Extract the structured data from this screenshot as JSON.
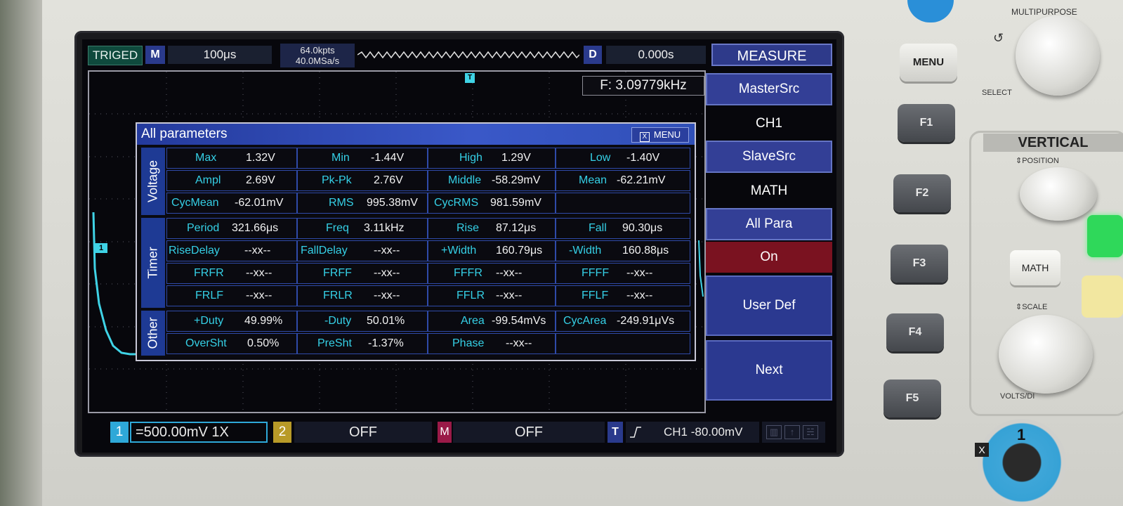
{
  "top_bar": {
    "trigger_status": "TRIGED",
    "mode_badge": "M",
    "timebase": "100μs",
    "memory_depth": "64.0kpts",
    "sample_rate": "40.0MSa/s",
    "delay_badge": "D",
    "delay": "0.000s",
    "menu_title": "MEASURE"
  },
  "frequency_readout": "F: 3.09779kHz",
  "markers": {
    "trigger": "T",
    "channel1": "1"
  },
  "panel": {
    "title": "All parameters",
    "close_icon": "X",
    "menu_label": "MENU",
    "groups": [
      {
        "label": "Voltage",
        "rows": [
          [
            {
              "name": "Max",
              "value": "1.32V"
            },
            {
              "name": "Min",
              "value": "-1.44V"
            },
            {
              "name": "High",
              "value": "1.29V"
            },
            {
              "name": "Low",
              "value": "-1.40V"
            }
          ],
          [
            {
              "name": "Ampl",
              "value": "2.69V"
            },
            {
              "name": "Pk-Pk",
              "value": "2.76V"
            },
            {
              "name": "Middle",
              "value": "-58.29mV"
            },
            {
              "name": "Mean",
              "value": "-62.21mV"
            }
          ],
          [
            {
              "name": "CycMean",
              "value": "-62.01mV"
            },
            {
              "name": "RMS",
              "value": "995.38mV"
            },
            {
              "name": "CycRMS",
              "value": "981.59mV"
            },
            {
              "name": "",
              "value": ""
            }
          ]
        ]
      },
      {
        "label": "Timer",
        "rows": [
          [
            {
              "name": "Period",
              "value": "321.66μs"
            },
            {
              "name": "Freq",
              "value": "3.11kHz"
            },
            {
              "name": "Rise",
              "value": "87.12μs"
            },
            {
              "name": "Fall",
              "value": "90.30μs"
            }
          ],
          [
            {
              "name": "RiseDelay",
              "value": "--xx--"
            },
            {
              "name": "FallDelay",
              "value": "--xx--"
            },
            {
              "name": "+Width",
              "value": "160.79μs"
            },
            {
              "name": "-Width",
              "value": "160.88μs"
            }
          ],
          [
            {
              "name": "FRFR",
              "value": "--xx--"
            },
            {
              "name": "FRFF",
              "value": "--xx--"
            },
            {
              "name": "FFFR",
              "value": "--xx--"
            },
            {
              "name": "FFFF",
              "value": "--xx--"
            }
          ],
          [
            {
              "name": "FRLF",
              "value": "--xx--"
            },
            {
              "name": "FRLR",
              "value": "--xx--"
            },
            {
              "name": "FFLR",
              "value": "--xx--"
            },
            {
              "name": "FFLF",
              "value": "--xx--"
            }
          ]
        ]
      },
      {
        "label": "Other",
        "rows": [
          [
            {
              "name": "+Duty",
              "value": "49.99%"
            },
            {
              "name": "-Duty",
              "value": "50.01%"
            },
            {
              "name": "Area",
              "value": "-99.54mVs"
            },
            {
              "name": "CycArea",
              "value": "-249.91μVs"
            }
          ],
          [
            {
              "name": "OverSht",
              "value": "0.50%"
            },
            {
              "name": "PreSht",
              "value": "-1.37%"
            },
            {
              "name": "Phase",
              "value": "--xx--"
            },
            {
              "name": "",
              "value": ""
            }
          ]
        ]
      }
    ]
  },
  "soft_menu": {
    "master_src_label": "MasterSrc",
    "master_src_value": "CH1",
    "slave_src_label": "SlaveSrc",
    "slave_src_value": "MATH",
    "all_para_label": "All Para",
    "all_para_value": "On",
    "user_def_label": "User Def",
    "next_label": "Next"
  },
  "bottom_bar": {
    "ch1_badge": "1",
    "ch1_setting": "=500.00mV 1X",
    "ch2_badge": "2",
    "ch2_setting": "OFF",
    "math_badge": "M",
    "math_setting": "OFF",
    "trigger_badge": "T",
    "trigger_setting": "CH1 -80.00mV"
  },
  "front_panel": {
    "menu_button": "MENU",
    "f_buttons": [
      "F1",
      "F2",
      "F3",
      "F4",
      "F5"
    ],
    "multipurpose_label": "MULTIPURPOSE",
    "select_label": "SELECT",
    "vertical_title": "VERTICAL",
    "position_label": "⇕POSITION",
    "math_button": "MATH",
    "scale_label": "⇕SCALE",
    "volts_label": "VOLTS/DI",
    "ch1_input": "1",
    "ground_mark": "X"
  },
  "colors": {
    "ch1_trace": "#3fd3e6",
    "menu_blue": "#333f96",
    "on_red": "#7a1220",
    "param_name": "#35d0e6"
  }
}
